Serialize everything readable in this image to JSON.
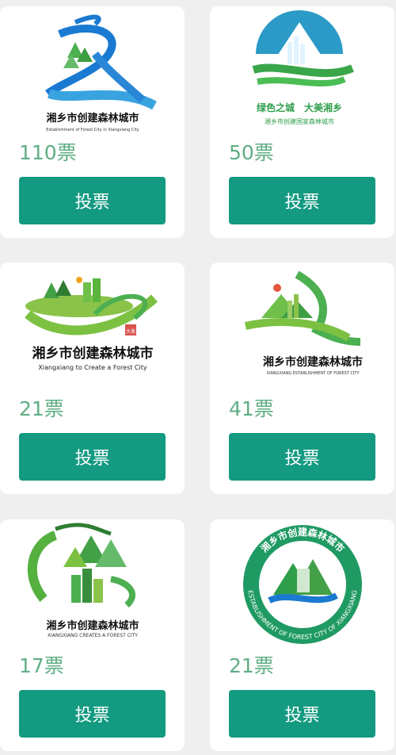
{
  "cards": [
    {
      "logo_title": "湘乡市创建森林城市",
      "logo_subtitle": "Establishment of Forest City in Xiangxiang City",
      "votes": "110票",
      "vote_label": "投票"
    },
    {
      "logo_title": "绿色之城　大美湘乡",
      "logo_subtitle": "湘乡市创建国家森林城市",
      "votes": "50票",
      "vote_label": "投票"
    },
    {
      "logo_title": "湘乡市创建森林城市",
      "logo_subtitle": "Xiangxiang to Create a Forest City",
      "logo_seal": "大美",
      "votes": "21票",
      "vote_label": "投票"
    },
    {
      "logo_title": "湘乡市创建森林城市",
      "logo_subtitle": "XIANGXIANG ESTABLISHMENT OF FOREST CITY",
      "votes": "41票",
      "vote_label": "投票"
    },
    {
      "logo_title": "湘乡市创建森林城市",
      "logo_subtitle": "XIANGXIANG CREATES A FOREST CITY",
      "votes": "17票",
      "vote_label": "投票"
    },
    {
      "logo_ring_top": "湘乡市创建森林城市",
      "logo_ring_bottom": "ESTABLISHMENT OF FOREST CITY OF XIANGXIANG",
      "votes": "21票",
      "vote_label": "投票"
    }
  ]
}
